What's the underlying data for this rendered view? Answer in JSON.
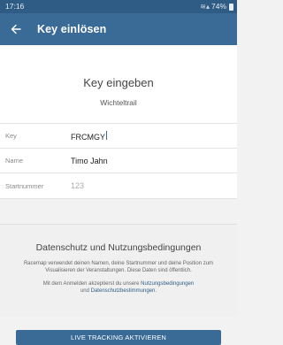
{
  "status_bar": {
    "time": "17:16",
    "battery": "74%"
  },
  "app_bar": {
    "back_icon": "arrow-left-icon",
    "title": "Key einlösen"
  },
  "heading": {
    "title": "Key eingeben",
    "subtitle": "Wichteltrail"
  },
  "form": {
    "key": {
      "label": "Key",
      "value": "FRCMGY"
    },
    "name": {
      "label": "Name",
      "value": "Timo Jahn"
    },
    "startnummer": {
      "label": "Startnummer",
      "placeholder": "123"
    }
  },
  "privacy": {
    "title": "Datenschutz und Nutzungsbedingungen",
    "text": "Racemap verwendet deinen Namen, deine Startnummer und deine Position zum Visualisieren der Veranstaltungen. Diese Daten sind öffentlich.",
    "consent_prefix": "Mit dem Anmelden akzeptierst du unsere",
    "terms_link": "Nutzungsbedingungen",
    "and": "und",
    "privacy_link": "Datenschutzbestimmungen",
    "period": "."
  },
  "actions": {
    "activate_label": "LIVE TRACKING AKTIVIEREN"
  },
  "colors": {
    "app_bar": "#3a6b96",
    "status_bar": "#2e5c84",
    "link": "#2e5c84"
  }
}
